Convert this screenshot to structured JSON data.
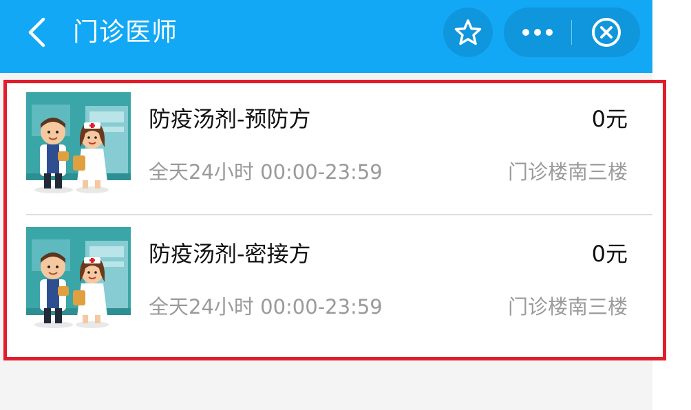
{
  "header": {
    "title": "门诊医师",
    "back_icon": "chevron-left-icon",
    "favorite_icon": "star-outline-icon",
    "more_icon": "more-dots-icon",
    "close_icon": "close-circle-icon"
  },
  "colors": {
    "header_bg": "#12a8f5",
    "capsule_bg": "#0f96dc",
    "highlight_border": "#e11d2b",
    "text_primary": "#111111",
    "text_secondary": "#9a9a9a"
  },
  "items": [
    {
      "name": "防疫汤剂-预防方",
      "price": "0元",
      "hours": "全天24小时 00:00-23:59",
      "location": "门诊楼南三楼",
      "image": "doctor-nurse-illustration"
    },
    {
      "name": "防疫汤剂-密接方",
      "price": "0元",
      "hours": "全天24小时 00:00-23:59",
      "location": "门诊楼南三楼",
      "image": "doctor-nurse-illustration"
    }
  ]
}
